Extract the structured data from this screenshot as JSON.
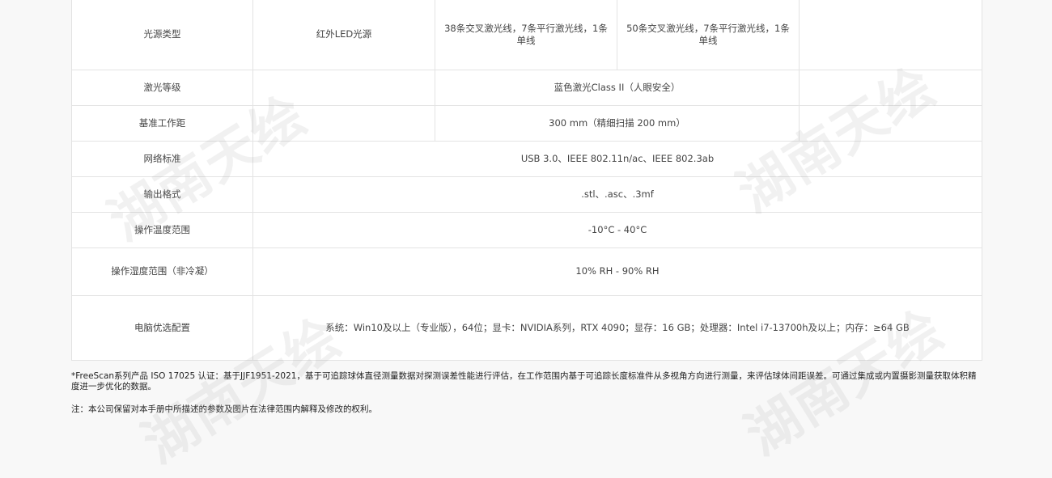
{
  "spec_rows": {
    "light_source": {
      "label": "光源类型",
      "col1": "红外LED光源",
      "col2": "38条交叉激光线，7条平行激光线，1条单线",
      "col3": "50条交叉激光线，7条平行激光线，1条单线"
    },
    "laser_class": {
      "label": "激光等级",
      "value": "蓝色激光Class II（人眼安全）"
    },
    "working_distance": {
      "label": "基准工作距",
      "value": "300 mm（精细扫描 200 mm）"
    },
    "network": {
      "label": "网络标准",
      "value": "USB 3.0、IEEE 802.11n/ac、IEEE 802.3ab"
    },
    "output_format": {
      "label": "输出格式",
      "value": ".stl、.asc、.3mf"
    },
    "operating_temp": {
      "label": "操作温度范围",
      "value": "-10°C - 40°C"
    },
    "operating_humidity": {
      "label": "操作湿度范围（非冷凝）",
      "value": "10% RH - 90% RH"
    },
    "pc_config": {
      "label": "电脑优选配置",
      "value": "系统：Win10及以上（专业版），64位；显卡：NVIDIA系列，RTX 4090；显存：16 GB；处理器：Intel i7-13700h及以上；内存：≥64 GB"
    }
  },
  "footnotes": {
    "accuracy": "*FreeScan系列产品 ISO 17025 认证：基于JJF1951-2021，基于可追踪球体直径测量数据对探测误差性能进行评估，在工作范围内基于可追踪长度标准件从多视角方向进行测量，来评估球体间距误差。可通过集成或内置摄影测量获取体积精度进一步优化的数据。",
    "disclaimer": "注：本公司保留对本手册中所描述的参数及图片在法律范围内解释及修改的权利。"
  },
  "watermark": {
    "text": "湖南天绘"
  }
}
